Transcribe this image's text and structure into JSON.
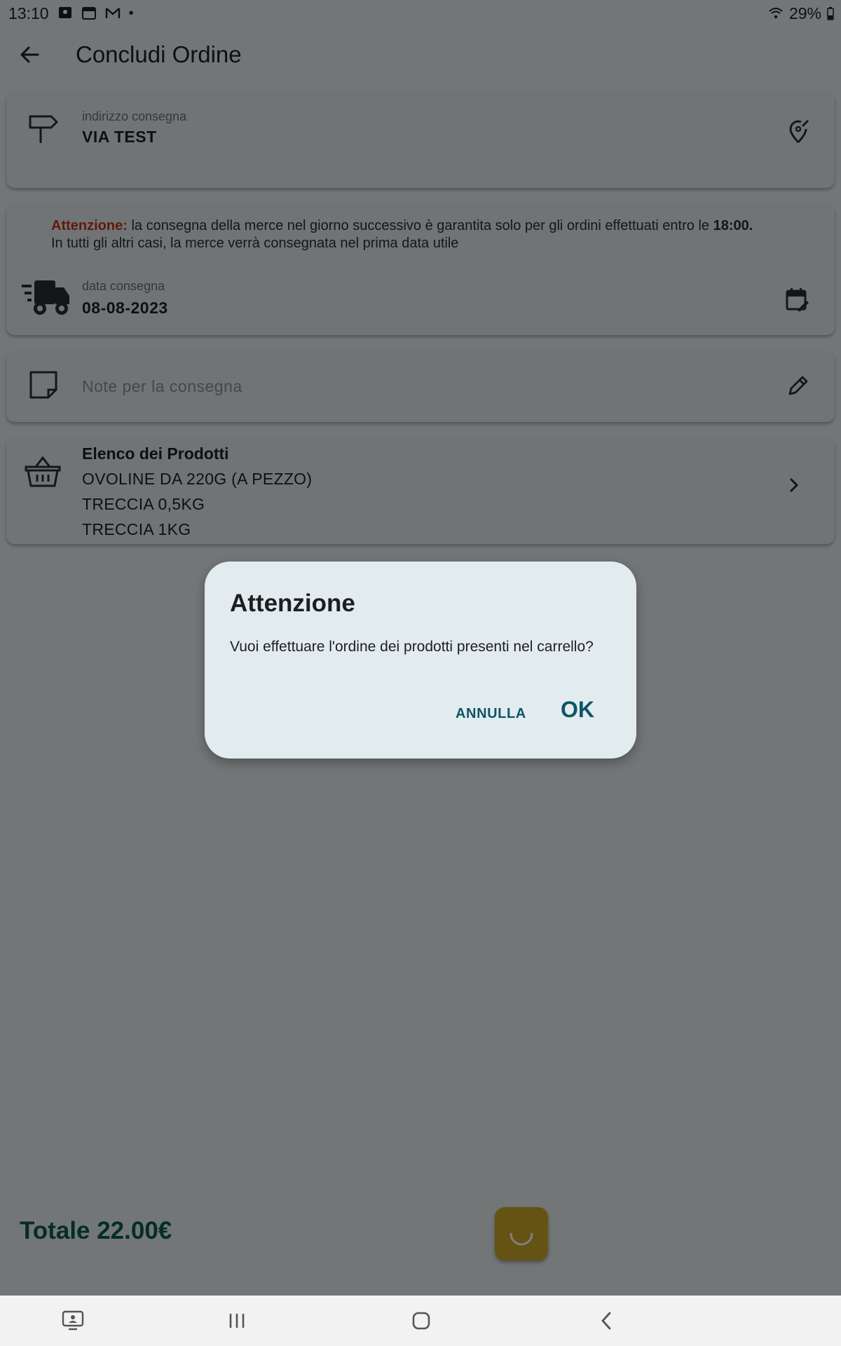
{
  "status_bar": {
    "time": "13:10",
    "notification_icons": [
      "assistant-icon",
      "calendar-icon",
      "gmail-icon",
      "dot-icon"
    ],
    "battery": "29%"
  },
  "app_bar": {
    "title": "Concludi Ordine"
  },
  "address": {
    "label": "indirizzo consegna",
    "value": "VIA TEST"
  },
  "delivery": {
    "notice_prefix": "Attenzione:",
    "notice_text": " la consegna della merce  nel giorno successivo è garantita solo per gli ordini effettuati entro le ",
    "notice_time": "18:00.",
    "notice_line2": "In tutti gli altri casi, la merce verrà consegnata nel prima data utile",
    "label": "data consegna",
    "value": "08-08-2023"
  },
  "notes": {
    "placeholder": "Note per la consegna"
  },
  "products": {
    "title": "Elenco dei Prodotti",
    "items": [
      "OVOLINE DA 220G (A PEZZO)",
      "TRECCIA 0,5KG",
      "TRECCIA 1KG"
    ]
  },
  "footer": {
    "total": "Totale 22.00€"
  },
  "dialog": {
    "title": "Attenzione",
    "message": "Vuoi effettuare l'ordine dei prodotti presenti nel carrello?",
    "cancel_label": "ANNULLA",
    "ok_label": "OK"
  },
  "colors": {
    "warning": "#c0341d",
    "total": "#0b5c4a",
    "fab": "#c9a726",
    "dialog_action": "#0d5566"
  }
}
